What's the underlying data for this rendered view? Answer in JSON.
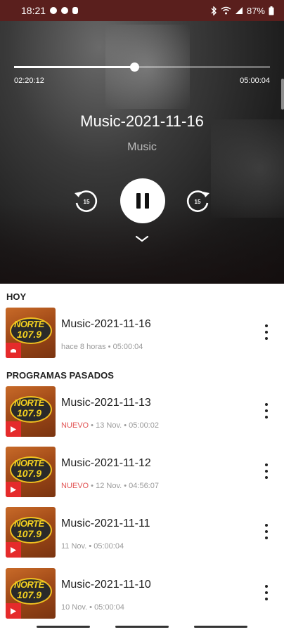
{
  "status_bar": {
    "time": "18:21",
    "battery": "87%"
  },
  "player": {
    "elapsed": "02:20:12",
    "total": "05:00:04",
    "progress": 0.47,
    "title": "Music-2021-11-16",
    "subtitle": "Music",
    "skip_back_label": "15",
    "skip_forward_label": "15"
  },
  "sections": {
    "today": "HOY",
    "past": "PROGRAMAS PASADOS"
  },
  "thumbnail": {
    "logo_name": "NORTE",
    "logo_freq": "107.9"
  },
  "episodes_today": [
    {
      "title": "Music-2021-11-16",
      "when": "hace 8 horas",
      "duration": "05:00:04"
    }
  ],
  "episodes_past": [
    {
      "title": "Music-2021-11-13",
      "badge": "NUEVO",
      "when": "13 Nov.",
      "duration": "05:00:02"
    },
    {
      "title": "Music-2021-11-12",
      "badge": "NUEVO",
      "when": "12 Nov.",
      "duration": "04:56:07"
    },
    {
      "title": "Music-2021-11-11",
      "when": "11 Nov.",
      "duration": "05:00:04"
    },
    {
      "title": "Music-2021-11-10",
      "when": "10 Nov.",
      "duration": "05:00:04"
    }
  ],
  "colors": {
    "status_bar": "#5a1f1d",
    "new_badge": "#e25555",
    "play_badge": "#e52b2b"
  }
}
